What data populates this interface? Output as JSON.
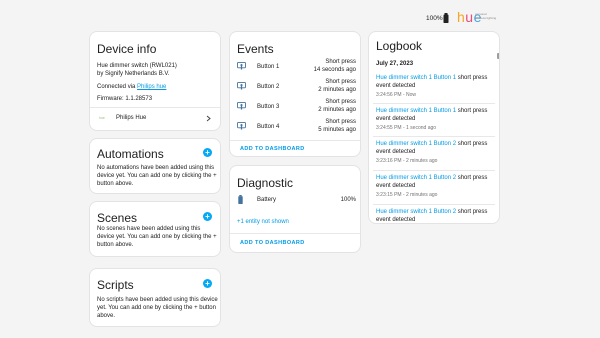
{
  "header": {
    "battery_pct": "100%",
    "brand_word": "hue",
    "brand_tag": "personal wireless lighting"
  },
  "device_info": {
    "title": "Device info",
    "model_line1": "Hue dimmer switch (RWL021)",
    "model_line2": "by Signify Netherlands B.V.",
    "connected_prefix": "Connected via ",
    "connected_link": "Philips hue",
    "firmware": "Firmware: 1.1.28573",
    "integration_label": "Philips Hue",
    "integration_logo": "hue"
  },
  "automations": {
    "title": "Automations",
    "text": "No automations have been added using this device yet. You can add one by clicking the + button above."
  },
  "scenes": {
    "title": "Scenes",
    "text": "No scenes have been added using this device yet. You can add one by clicking the + button above."
  },
  "scripts": {
    "title": "Scripts",
    "text": "No scripts have been added using this device yet. You can add one by clicking the + button above."
  },
  "events": {
    "title": "Events",
    "items": [
      {
        "name": "Button 1",
        "state": "Short press",
        "time": "14 seconds ago"
      },
      {
        "name": "Button 2",
        "state": "Short press",
        "time": "2 minutes ago"
      },
      {
        "name": "Button 3",
        "state": "Short press",
        "time": "2 minutes ago"
      },
      {
        "name": "Button 4",
        "state": "Short press",
        "time": "5 minutes ago"
      }
    ],
    "add_label": "ADD TO DASHBOARD"
  },
  "diagnostic": {
    "title": "Diagnostic",
    "entity_name": "Battery",
    "entity_value": "100%",
    "hidden_text": "+1 entity not shown",
    "add_label": "ADD TO DASHBOARD"
  },
  "logbook": {
    "title": "Logbook",
    "date": "July 27, 2023",
    "entries": [
      {
        "entity": "Hue dimmer switch 1 Button 1",
        "message": " short press event detected",
        "time": "3:24:56 PM - Now"
      },
      {
        "entity": "Hue dimmer switch 1 Button 1",
        "message": " short press event detected",
        "time": "3:24:55 PM - 1 second ago"
      },
      {
        "entity": "Hue dimmer switch 1 Button 2",
        "message": " short press event detected",
        "time": "3:23:16 PM - 2 minutes ago"
      },
      {
        "entity": "Hue dimmer switch 1 Button 2",
        "message": " short press event detected",
        "time": "3:23:15 PM - 2 minutes ago"
      },
      {
        "entity": "Hue dimmer switch 1 Button 2",
        "message": " short press event detected",
        "time": ""
      }
    ]
  },
  "colors": {
    "accent": "#03a9f4",
    "link": "#039be5",
    "background": "#f4f4f4"
  }
}
